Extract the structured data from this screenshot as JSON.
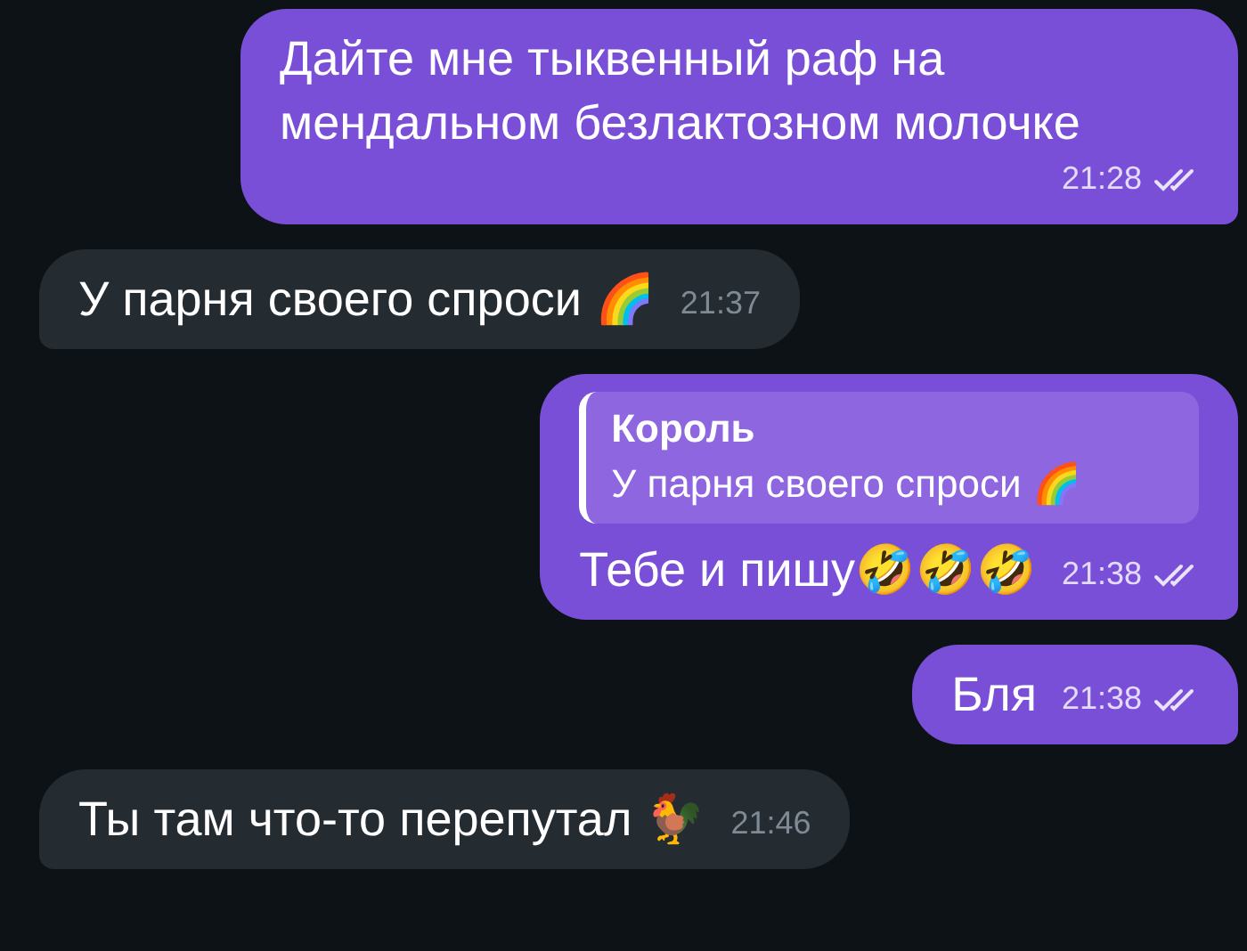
{
  "messages": [
    {
      "kind": "outgoing",
      "text": "Дайте мне тыквенный раф на мендальном безлактозном молочке",
      "time": "21:28",
      "read": true
    },
    {
      "kind": "incoming",
      "text": "У парня своего спроси 🌈",
      "time": "21:37"
    },
    {
      "kind": "outgoing",
      "reply": {
        "author": "Король",
        "text": "У парня своего спроси 🌈"
      },
      "text": "Тебе и пишу🤣🤣🤣",
      "time": "21:38",
      "read": true
    },
    {
      "kind": "outgoing",
      "text": "Бля",
      "time": "21:38",
      "read": true
    },
    {
      "kind": "incoming",
      "text": "Ты там что-то перепутал 🐓",
      "time": "21:46"
    }
  ]
}
